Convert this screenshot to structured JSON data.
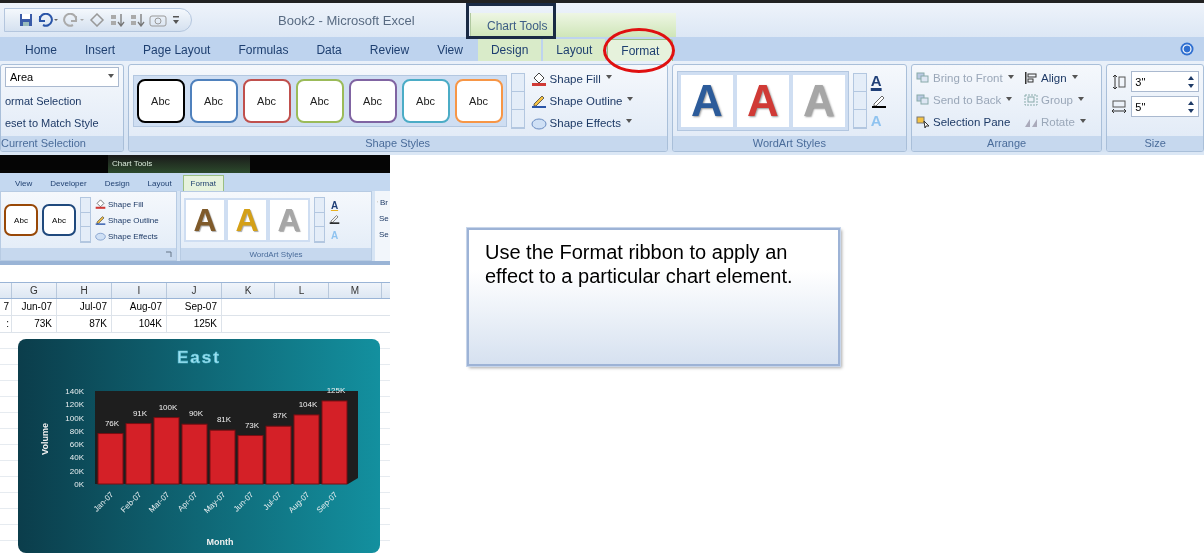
{
  "window": {
    "title": "Book2 - Microsoft Excel",
    "contextual_group": "Chart Tools"
  },
  "tabs": [
    {
      "label": "Home",
      "selected": false
    },
    {
      "label": "Insert",
      "selected": false
    },
    {
      "label": "Page Layout",
      "selected": false
    },
    {
      "label": "Formulas",
      "selected": false
    },
    {
      "label": "Data",
      "selected": false
    },
    {
      "label": "Review",
      "selected": false
    },
    {
      "label": "View",
      "selected": false
    },
    {
      "label": "Design",
      "selected": false
    },
    {
      "label": "Layout",
      "selected": false
    },
    {
      "label": "Format",
      "selected": true
    }
  ],
  "ribbon": {
    "current_selection": {
      "dropdown": "Area",
      "buttons": [
        "ormat Selection",
        "eset to Match Style"
      ],
      "label": "Current Selection"
    },
    "shape_styles": {
      "label": "Shape Styles",
      "swatches": [
        {
          "label": "Abc",
          "color": "#000000"
        },
        {
          "label": "Abc",
          "color": "#4f81bd"
        },
        {
          "label": "Abc",
          "color": "#c0504d"
        },
        {
          "label": "Abc",
          "color": "#9bbb59"
        },
        {
          "label": "Abc",
          "color": "#8064a2"
        },
        {
          "label": "Abc",
          "color": "#4bacc6"
        },
        {
          "label": "Abc",
          "color": "#f79646"
        }
      ],
      "commands": [
        {
          "kind": "fill",
          "label": "Shape Fill"
        },
        {
          "kind": "outline",
          "label": "Shape Outline"
        },
        {
          "kind": "effects",
          "label": "Shape Effects"
        }
      ]
    },
    "wordart_styles": {
      "label": "WordArt Styles",
      "samples": [
        {
          "glyph": "A",
          "color": "#2c5b9a"
        },
        {
          "glyph": "A",
          "color": "#d03a36"
        },
        {
          "glyph": "A",
          "color": "#a6a6a6"
        }
      ],
      "commands": [
        {
          "kind": "text_fill",
          "glyph": "A"
        },
        {
          "kind": "text_outline"
        },
        {
          "kind": "text_effects",
          "glyph": "A"
        }
      ]
    },
    "arrange": {
      "label": "Arrange",
      "commands": [
        {
          "kind": "front",
          "label": "Bring to Front",
          "disabled": true
        },
        {
          "kind": "back",
          "label": "Send to Back",
          "disabled": true
        },
        {
          "kind": "pane",
          "label": "Selection Pane",
          "disabled": false
        },
        {
          "kind": "align",
          "label": "Align",
          "disabled": false
        },
        {
          "kind": "group",
          "label": "Group",
          "disabled": true
        },
        {
          "kind": "rotate",
          "label": "Rotate",
          "disabled": true
        }
      ]
    },
    "size": {
      "label": "Size",
      "fields": [
        {
          "kind": "height",
          "value": "3\""
        },
        {
          "kind": "width",
          "value": "5\""
        }
      ]
    }
  },
  "inset": {
    "contextual_group": "Chart Tools",
    "tabs": [
      {
        "label": "View",
        "selected": false
      },
      {
        "label": "Developer",
        "selected": false
      },
      {
        "label": "Design",
        "selected": false
      },
      {
        "label": "Layout",
        "selected": false
      },
      {
        "label": "Format",
        "selected": true
      }
    ],
    "swatches": [
      {
        "label": "Abc",
        "color": "#984807"
      },
      {
        "label": "Abc",
        "color": "#1f497d"
      }
    ],
    "commands": [
      {
        "kind": "fill",
        "label": "Shape Fill"
      },
      {
        "kind": "outline",
        "label": "Shape Outline"
      },
      {
        "kind": "effects",
        "label": "Shape Effects"
      }
    ],
    "wordart": {
      "label": "WordArt Styles",
      "samples": [
        {
          "glyph": "A",
          "color": "#7f5a2a"
        },
        {
          "glyph": "A",
          "color": "#d4a017"
        },
        {
          "glyph": "A",
          "color": "#a6a6a6"
        }
      ],
      "commands": [
        {
          "kind": "text_fill",
          "glyph": "A"
        },
        {
          "kind": "text_outline"
        },
        {
          "kind": "text_effects",
          "glyph": "A"
        }
      ]
    },
    "arrange_partial": [
      "Br",
      "Se",
      "Se"
    ],
    "sheet": {
      "columns": [
        "G",
        "H",
        "I",
        "J",
        "K",
        "L",
        "M"
      ],
      "rows": [
        {
          "cells": [
            "7",
            "Jun-07",
            "Jul-07",
            "Aug-07",
            "Sep-07"
          ]
        },
        {
          "cells": [
            ":",
            "73K",
            "87K",
            "104K",
            "125K"
          ]
        }
      ]
    },
    "chart": {
      "chart_data": {
        "type": "bar",
        "title": "East",
        "xlabel": "Month",
        "ylabel": "Volume",
        "categories": [
          "Jan-07",
          "Feb-07",
          "Mar-07",
          "Apr-07",
          "May-07",
          "Jun-07",
          "Jul-07",
          "Aug-07",
          "Sep-07"
        ],
        "values": [
          76,
          91,
          100,
          90,
          81,
          73,
          87,
          104,
          125
        ],
        "value_labels": [
          "76K",
          "91K",
          "100K",
          "90K",
          "81K",
          "73K",
          "87K",
          "104K",
          "125K"
        ],
        "ylim": [
          0,
          140
        ],
        "yticks": [
          {
            "value": 0,
            "label": "0K"
          },
          {
            "value": 20,
            "label": "20K"
          },
          {
            "value": 40,
            "label": "40K"
          },
          {
            "value": 60,
            "label": "60K"
          },
          {
            "value": 80,
            "label": "80K"
          },
          {
            "value": 100,
            "label": "100K"
          },
          {
            "value": 120,
            "label": "120K"
          },
          {
            "value": 140,
            "label": "140K"
          }
        ]
      }
    }
  },
  "callout": {
    "text": "Use the Format ribbon to apply an effect to a particular chart element."
  }
}
